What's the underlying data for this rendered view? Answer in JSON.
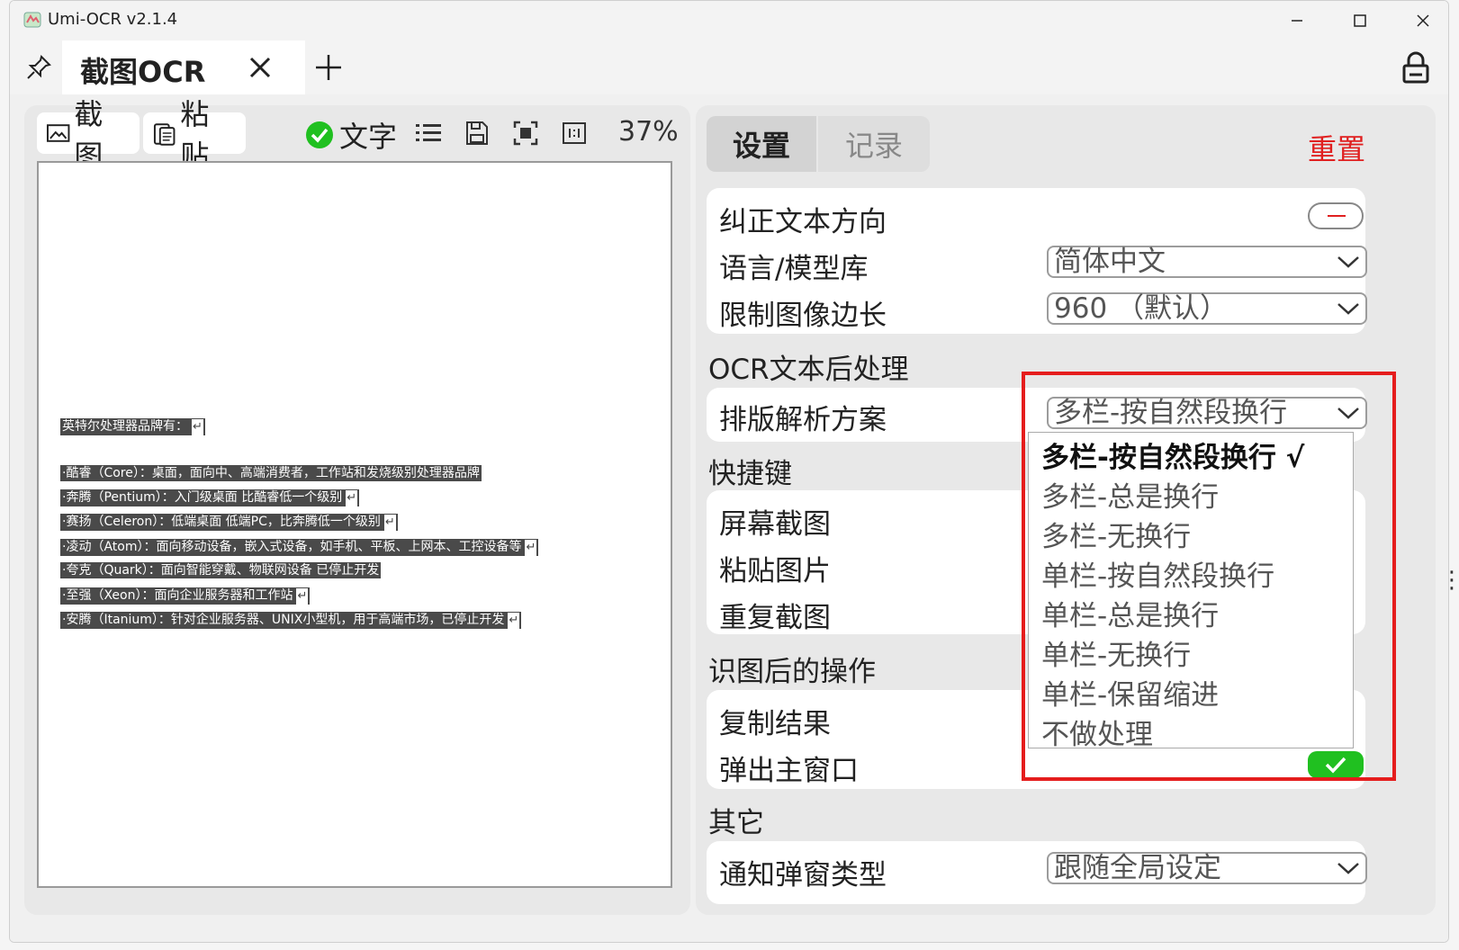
{
  "window": {
    "title": "Umi-OCR v2.1.4",
    "minimize": "—",
    "maximize": "☐",
    "close": "✕"
  },
  "tabs": {
    "active_label": "截图OCR",
    "close_glyph": "✕",
    "add_glyph": "+"
  },
  "toolbar": {
    "screenshot_label": "截图",
    "paste_label": "粘贴",
    "text_label": "文字",
    "zoom": "37%"
  },
  "ocr_preview": {
    "lines": [
      "英特尔处理器品牌有：",
      "·酷睿（Core）：桌面，面向中、高端消费者，工作站和发烧级别处理器品牌",
      "·奔腾（Pentium）：入门级桌面 比酷睿低一个级别",
      "·赛扬（Celeron）：低端桌面 低端PC，比奔腾低一个级别",
      "·凌动（Atom）：面向移动设备，嵌入式设备，如手机、平板、上网本、工控设备等",
      "·夸克（Quark）：面向智能穿戴、物联网设备 已停止开发",
      "·至强（Xeon）：面向企业服务器和工作站",
      "·安腾（Itanium）：针对企业服务器、UNIX小型机，用于高端市场，已停止开发"
    ],
    "return_mark": "↵"
  },
  "settings_panel": {
    "tab_settings": "设置",
    "tab_records": "记录",
    "reset": "重置",
    "correct_direction": "纠正文本方向",
    "language_label": "语言/模型库",
    "language_value": "简体中文",
    "limit_label": "限制图像边长",
    "limit_value": "960 （默认）",
    "post_title": "OCR文本后处理",
    "layout_label": "排版解析方案",
    "layout_value": "多栏-按自然段换行",
    "shortcut_title": "快捷键",
    "screen_capture": "屏幕截图",
    "paste_image": "粘贴图片",
    "repeat_capture": "重复截图",
    "after_title": "识图后的操作",
    "copy_result": "复制结果",
    "popup_main": "弹出主窗口",
    "other_title": "其它",
    "notify_label": "通知弹窗类型",
    "notify_value": "跟随全局设定"
  },
  "dropdown": {
    "options": [
      "多栏-按自然段换行 √",
      "多栏-总是换行",
      "多栏-无换行",
      "单栏-按自然段换行",
      "单栏-总是换行",
      "单栏-无换行",
      "单栏-保留缩进",
      "不做处理"
    ]
  },
  "colors": {
    "accent_red": "#e02020",
    "toggle_green": "#20c020",
    "highlight_border": "#e51d1d"
  },
  "icons": [
    "app-icon",
    "pin-icon",
    "close-icon",
    "plus-icon",
    "lock-icon",
    "image-icon",
    "clipboard-icon",
    "check-icon",
    "list-icon",
    "save-icon",
    "fit-screen-icon",
    "original-size-icon",
    "chevron-down-icon"
  ]
}
